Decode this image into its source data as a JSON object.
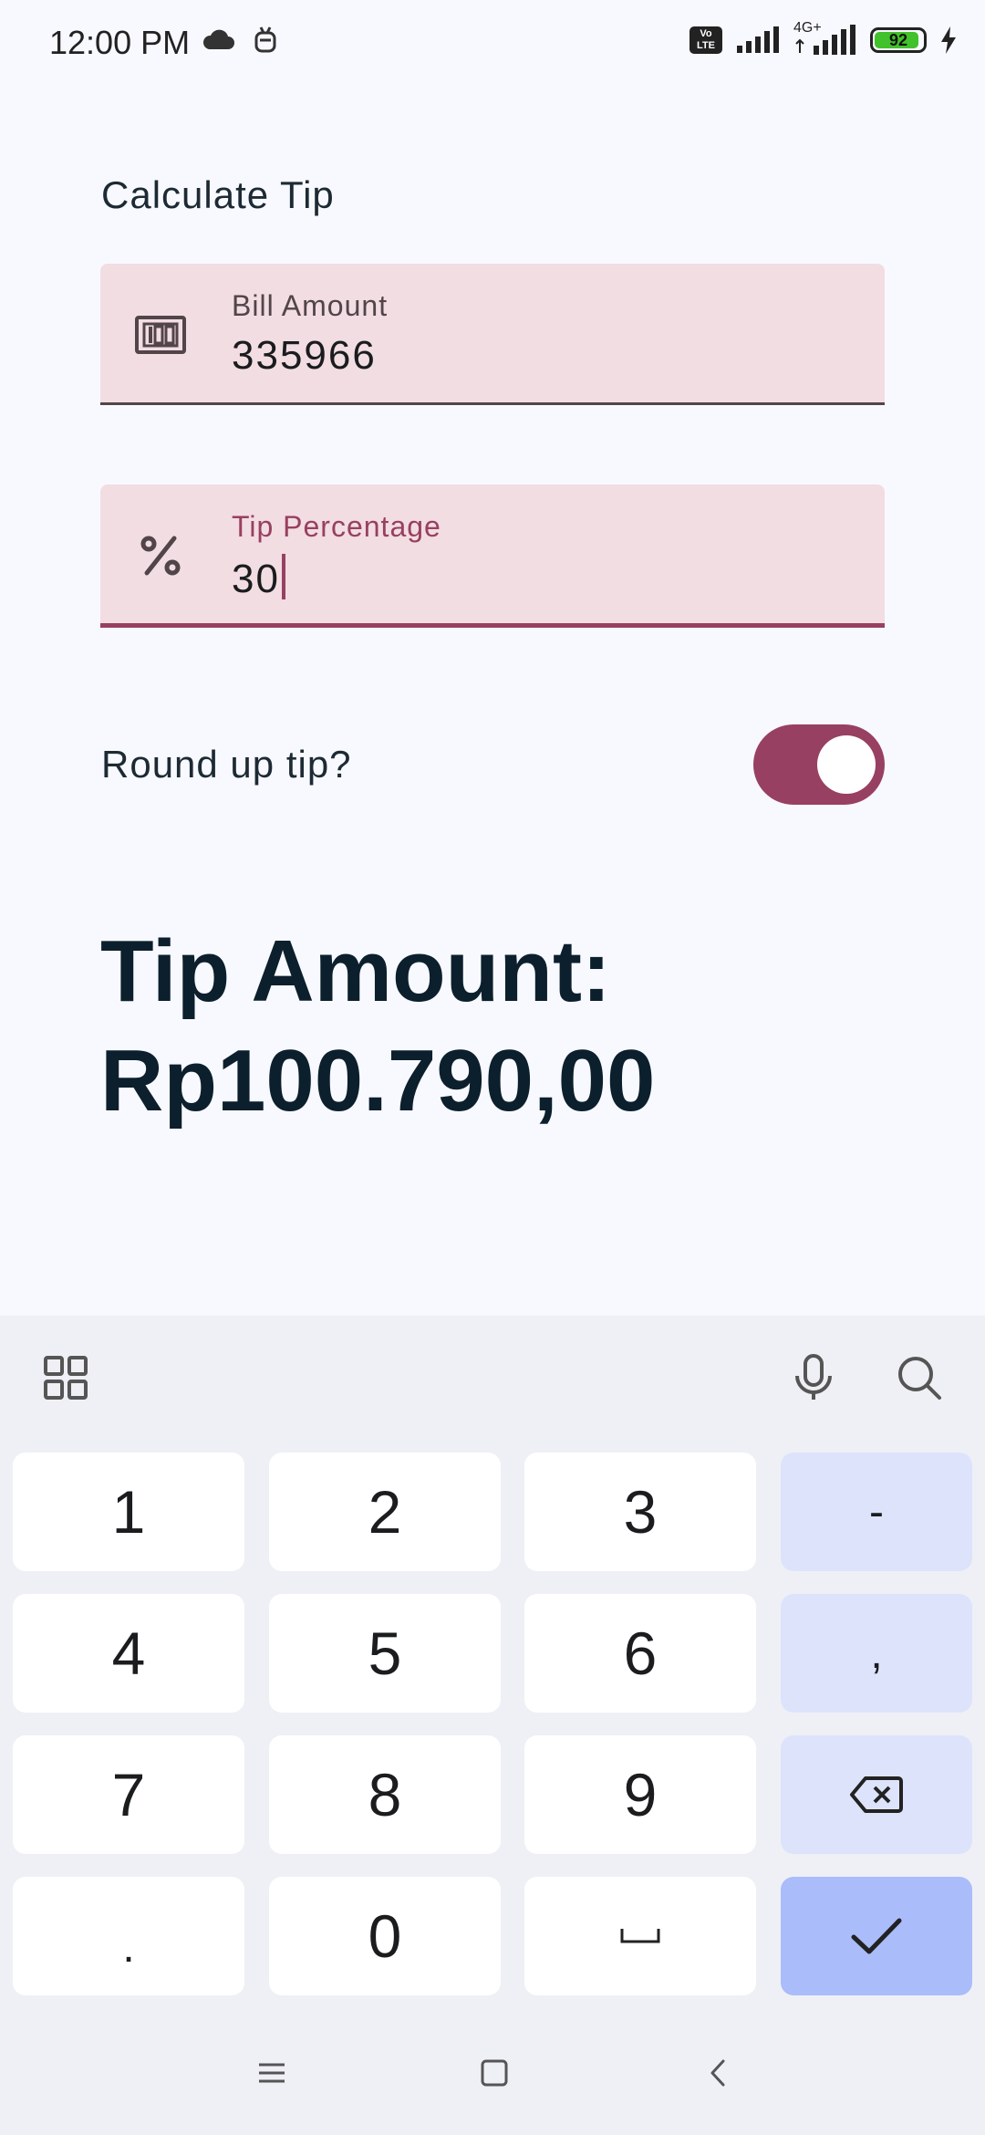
{
  "status_bar": {
    "time": "12:00 PM",
    "network": "4G+",
    "volte": "Vo LTE",
    "battery": "92",
    "battery_level": 0.92
  },
  "screen": {
    "title": "Calculate Tip",
    "bill_field": {
      "label": "Bill Amount",
      "value": "335966",
      "icon": "money-icon"
    },
    "tip_field": {
      "label": "Tip Percentage",
      "value": "30",
      "icon": "percent-icon"
    },
    "round_up": {
      "label": "Round up tip?",
      "checked": true
    },
    "tip_amount_label": "Tip Amount:",
    "tip_amount_value": "Rp100.790,00"
  },
  "keyboard": {
    "toolbar_icons": [
      "apps-grid-icon",
      "microphone-icon",
      "search-icon"
    ],
    "keys": {
      "k1": "1",
      "k2": "2",
      "k3": "3",
      "minus": "-",
      "k4": "4",
      "k5": "5",
      "k6": "6",
      "comma": ",",
      "k7": "7",
      "k8": "8",
      "k9": "9",
      "dot": ".",
      "k0": "0"
    },
    "icons": {
      "backspace": "backspace-icon",
      "space": "space-icon",
      "enter": "checkmark-icon"
    }
  },
  "nav_bar": {
    "icons": [
      "menu-icon",
      "home-icon",
      "back-icon"
    ]
  },
  "colors": {
    "accent": "#984061",
    "field_bg": "#f2dde2",
    "background": "#f8f9ff",
    "key_side": "#dde3fb",
    "key_enter": "#aabcfa"
  }
}
